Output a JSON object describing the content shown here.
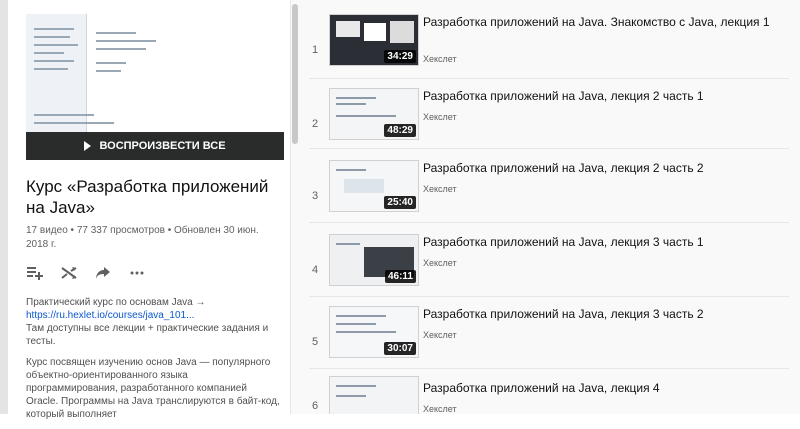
{
  "playlist": {
    "play_all": "ВОСПРОИЗВЕСТИ ВСЕ",
    "title": "Курс «Разработка приложений на Java»",
    "meta": "17 видео • 77 337 просмотров • Обновлен 30 июн. 2018 г.",
    "actions": [
      "add-to-queue",
      "shuffle",
      "share",
      "more"
    ],
    "description": {
      "p1_text": "Практический курс по основам Java →",
      "p1_link": "https://ru.hexlet.io/courses/java_101...",
      "p1_tail": "Там доступны все лекции + практические задания и тесты.",
      "p2": "Курс посвящен изучению основ Java — популярного объектно-ориентированного языка программирования, разработанного компанией Oracle. Программы на Java транслируются в байт-код, который выполняет"
    }
  },
  "videos": [
    {
      "index": "1",
      "title": "Разработка приложений на Java. Знакомство с Java, лекция 1",
      "channel": "Хекслет",
      "duration": "34:29"
    },
    {
      "index": "2",
      "title": "Разработка приложений на Java, лекция 2 часть 1",
      "channel": "Хекслет",
      "duration": "48:29"
    },
    {
      "index": "3",
      "title": "Разработка приложений на Java, лекция 2 часть 2",
      "channel": "Хекслет",
      "duration": "25:40"
    },
    {
      "index": "4",
      "title": "Разработка приложений на Java, лекция 3 часть 1",
      "channel": "Хекслет",
      "duration": "46:11"
    },
    {
      "index": "5",
      "title": "Разработка приложений на Java, лекция 3 часть 2",
      "channel": "Хекслет",
      "duration": "30:07"
    },
    {
      "index": "6",
      "title": "Разработка приложений на Java, лекция 4",
      "channel": "Хекслет",
      "duration": ""
    }
  ]
}
